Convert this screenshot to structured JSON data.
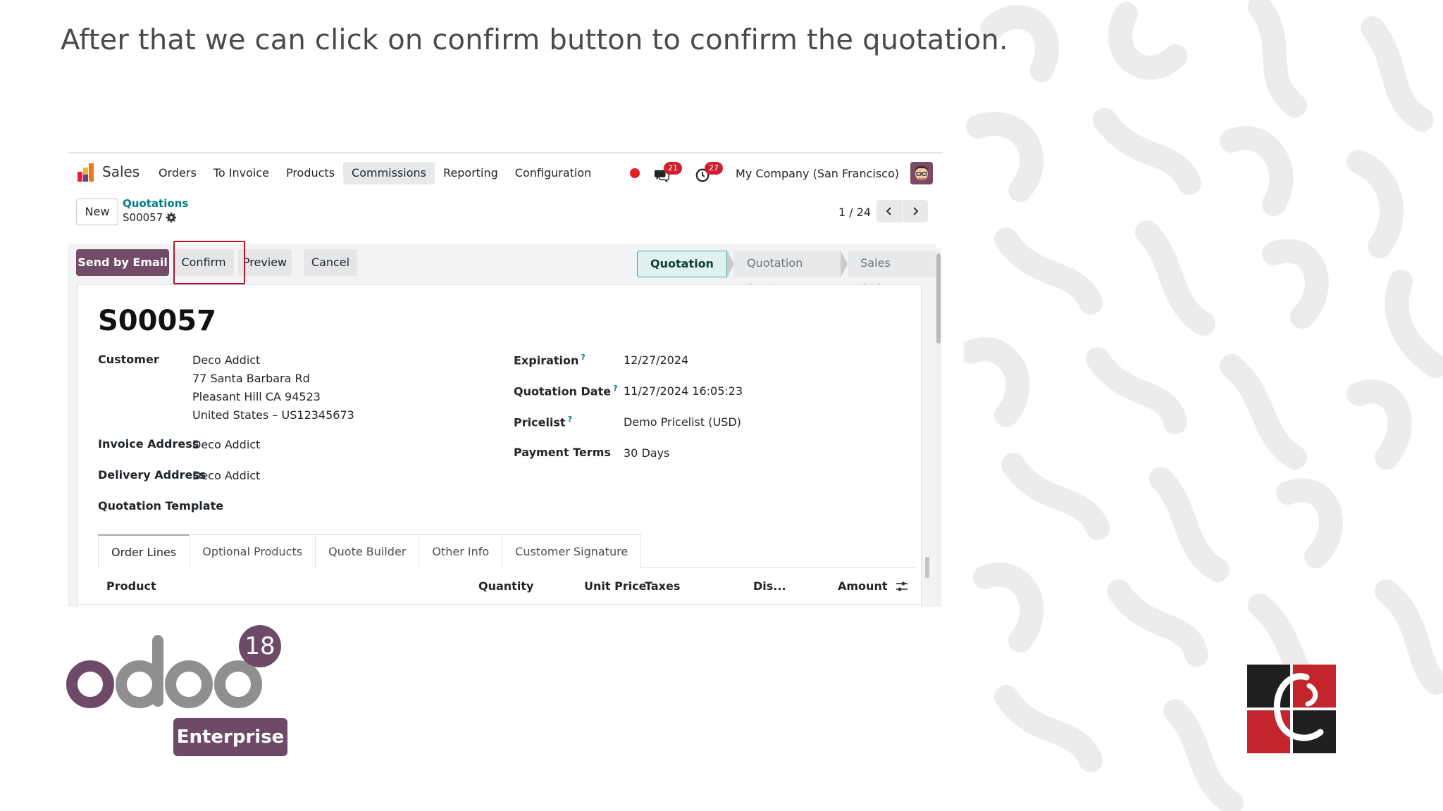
{
  "caption": "After that we can click on confirm button to confirm the quotation.",
  "navbar": {
    "app_name": "Sales",
    "menu": [
      {
        "label": "Orders",
        "active": false
      },
      {
        "label": "To Invoice",
        "active": false
      },
      {
        "label": "Products",
        "active": false
      },
      {
        "label": "Commissions",
        "active": true
      },
      {
        "label": "Reporting",
        "active": false
      },
      {
        "label": "Configuration",
        "active": false
      }
    ],
    "messages_count": "21",
    "activities_count": "27",
    "company": "My Company (San Francisco)"
  },
  "controlbar": {
    "new_label": "New",
    "breadcrumb_parent": "Quotations",
    "breadcrumb_current": "S00057",
    "pager": "1 / 24"
  },
  "statusbar": {
    "send_by_email": "Send by Email",
    "confirm": "Confirm",
    "preview": "Preview",
    "cancel": "Cancel",
    "stages": [
      "Quotation",
      "Quotation Sent",
      "Sales Order"
    ],
    "current_stage": "Quotation"
  },
  "form": {
    "reference": "S00057",
    "customer_label": "Customer",
    "customer_lines": [
      "Deco Addict",
      "77 Santa Barbara Rd",
      "Pleasant Hill CA 94523",
      "United States – US12345673"
    ],
    "invoice_address_label": "Invoice Address",
    "invoice_address": "Deco Addict",
    "delivery_address_label": "Delivery Address",
    "delivery_address": "Deco Addict",
    "quotation_template_label": "Quotation Template",
    "expiration_label": "Expiration",
    "expiration": "12/27/2024",
    "quotation_date_label": "Quotation Date",
    "quotation_date": "11/27/2024 16:05:23",
    "pricelist_label": "Pricelist",
    "pricelist": "Demo Pricelist (USD)",
    "payment_terms_label": "Payment Terms",
    "payment_terms": "30 Days",
    "help_mark": "?"
  },
  "tabs": [
    "Order Lines",
    "Optional Products",
    "Quote Builder",
    "Other Info",
    "Customer Signature"
  ],
  "table_columns": [
    "Product",
    "Quantity",
    "Unit Price",
    "Taxes",
    "Dis...",
    "Amount"
  ],
  "branding": {
    "odoo_version": "18",
    "edition": "Enterprise"
  },
  "colors": {
    "primary": "#714b67",
    "highlight": "#b0162a",
    "link": "#017e84"
  }
}
